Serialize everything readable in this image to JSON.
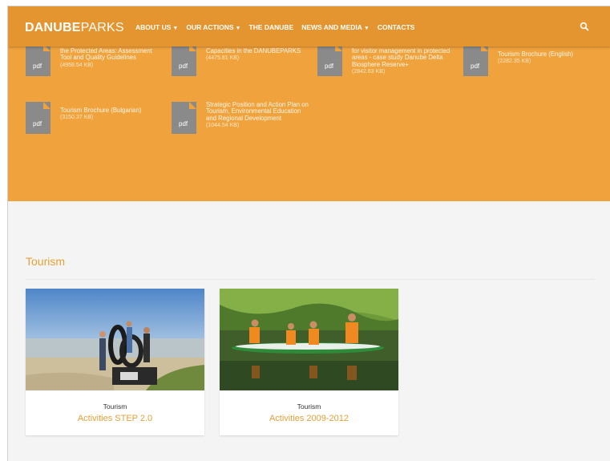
{
  "brand": {
    "logo_bold": "DANUBE",
    "logo_light": "PARKS"
  },
  "nav": {
    "items": [
      {
        "label": "About us",
        "has_dropdown": true
      },
      {
        "label": "Our actions",
        "has_dropdown": true
      },
      {
        "label": "The Danube",
        "has_dropdown": false
      },
      {
        "label": "News and media",
        "has_dropdown": true
      },
      {
        "label": "Contacts",
        "has_dropdown": false
      }
    ],
    "search_icon": "search-icon"
  },
  "documents": [
    {
      "icon_label": "pdf",
      "title": "the Protected Areas: Assessment Tool and Quality Guidelines",
      "size": "(4958.54 KB)"
    },
    {
      "icon_label": "pdf",
      "title": "Capacities in the DANUBEPARKS",
      "size": "(4475.81 KB)"
    },
    {
      "icon_label": "pdf",
      "title": "for visitor management in protected areas - case study Danube Delta Biosphere Reserve+",
      "size": "(2842.63 KB)"
    },
    {
      "icon_label": "pdf",
      "title": "Tourism Brochure (English)",
      "size": "(2282.35 KB)"
    },
    {
      "icon_label": "pdf",
      "title": "Tourism Brochure (Bulgarian)",
      "size": "(3150.37 KB)"
    },
    {
      "icon_label": "pdf",
      "title": "Strategic Position and Action Plan on Tourism, Environmental Education and Regional Development",
      "size": "(1044.54 KB)"
    }
  ],
  "tourism": {
    "heading": "Tourism",
    "cards": [
      {
        "category": "Tourism",
        "title": "Activities STEP 2.0"
      },
      {
        "category": "Tourism",
        "title": "Activities 2009-2012"
      }
    ]
  },
  "colors": {
    "accent_orange": "#f0a23d",
    "navbar_orange": "#e49530",
    "link_orange": "#e6a036",
    "pdf_icon_grey": "#8a8a8a"
  }
}
